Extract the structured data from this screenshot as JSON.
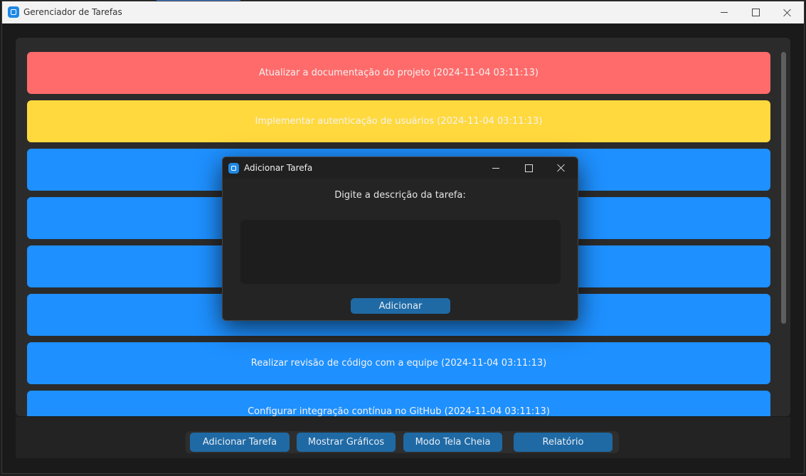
{
  "window": {
    "title": "Gerenciador de Tarefas"
  },
  "tasks": [
    {
      "text": "Atualizar a documentação do projeto (2024-11-04 03:11:13)",
      "color": "#ff6b6b"
    },
    {
      "text": "Implementar autenticação de usuários (2024-11-04 03:11:13)",
      "color": "#ffd93d"
    },
    {
      "text": "",
      "color": "#1e90ff"
    },
    {
      "text": "",
      "color": "#1e90ff"
    },
    {
      "text": "",
      "color": "#1e90ff"
    },
    {
      "text": "",
      "color": "#1e90ff"
    },
    {
      "text": "Realizar revisão de código com a equipe (2024-11-04 03:11:13)",
      "color": "#1e90ff"
    },
    {
      "text": "Configurar integração contínua no GitHub (2024-11-04 03:11:13)",
      "color": "#1e90ff"
    }
  ],
  "footer": {
    "buttons": [
      "Adicionar Tarefa",
      "Mostrar Gráficos",
      "Modo Tela Cheia",
      "Relatório"
    ]
  },
  "dialog": {
    "title": "Adicionar Tarefa",
    "prompt": "Digite a descrição da tarefa:",
    "input_value": "",
    "submit_label": "Adicionar"
  },
  "colors": {
    "accent": "#1f6aa5",
    "priority_high": "#ff6b6b",
    "priority_medium": "#ffd93d",
    "priority_low": "#1e90ff"
  },
  "icons": [
    "app-icon",
    "minimize-icon",
    "maximize-icon",
    "close-icon"
  ]
}
